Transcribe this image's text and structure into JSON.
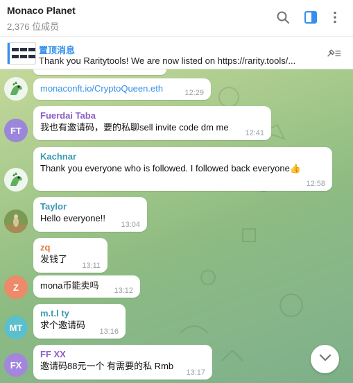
{
  "header": {
    "title": "Monaco Planet",
    "subtitle": "2,376 位成员",
    "icons": [
      "search-icon",
      "sidebar-toggle-icon",
      "more-vertical-icon"
    ]
  },
  "pinned": {
    "title": "置顶消息",
    "text": "Thank you Raritytools! We are now listed on  https://rarity.tools/...",
    "icon": "unpin-list-icon"
  },
  "messages": [
    {
      "sender": "",
      "text": "monaconft.io/CryptoQueen.eth",
      "time": "12:29",
      "avatar": "dino-image",
      "is_link": true
    },
    {
      "sender": "Fuerdai Taba",
      "sender_color": "#8b5cc7",
      "text": "我也有邀请码，要的私聊sell invite code dm me",
      "time": "12:41",
      "avatar_initials": "FT",
      "avatar_color": "#9b87d9"
    },
    {
      "sender": "Kachnar",
      "sender_color": "#3a9bb0",
      "text": "Thank you everyone who is followed. I followed back everyone👍",
      "time": "12:58",
      "avatar": "dino-image"
    },
    {
      "sender": "Taylor",
      "sender_color": "#3a9bb0",
      "text": "Hello everyone!!",
      "time": "13:04",
      "avatar": "photo"
    },
    {
      "sender": "zq",
      "sender_color": "#e07a3c",
      "text": "发钱了",
      "time": "13:11",
      "avatar": "none"
    },
    {
      "sender": "",
      "text": "mona币能卖吗",
      "time": "13:12",
      "avatar_initials": "Z",
      "avatar_color": "#ec8a6a"
    },
    {
      "sender": "m.t.l ty",
      "sender_color": "#3a9bb0",
      "text": "求个邀请码",
      "time": "13:16",
      "avatar_initials": "MT",
      "avatar_color": "#5bbfcc"
    },
    {
      "sender": "FF XX",
      "sender_color": "#8b5cc7",
      "text": "邀请码88元一个 有需要的私 Rmb",
      "time": "13:17",
      "avatar_initials": "FX",
      "avatar_color": "#a486de"
    }
  ],
  "scroll_button": {
    "icon": "chevron-down-icon"
  }
}
